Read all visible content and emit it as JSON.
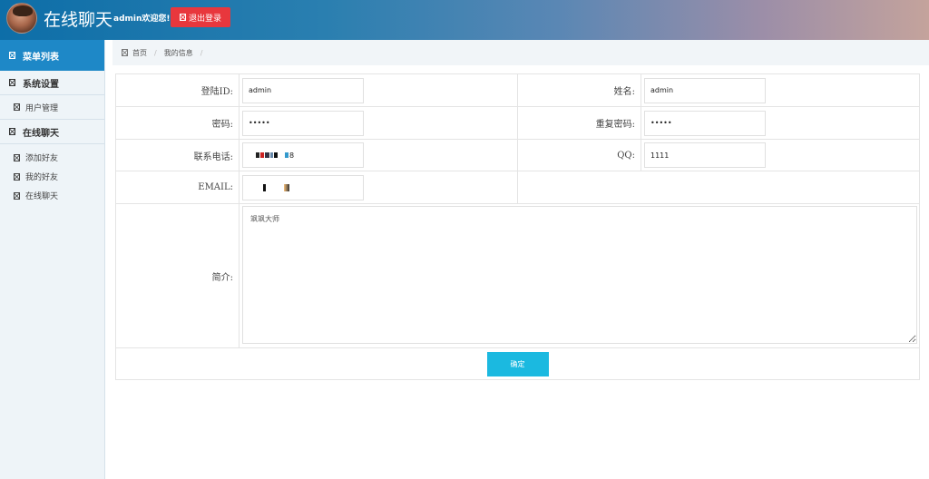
{
  "header": {
    "app_title": "在线聊天",
    "welcome_text": "admin欢迎您!",
    "logout_label": "退出登录",
    "logout_color": "#e8373d"
  },
  "sidebar": {
    "menu_title": "菜单列表",
    "groups": [
      {
        "label": "系统设置",
        "items": [
          {
            "label": "用户管理"
          }
        ]
      },
      {
        "label": "在线聊天",
        "items": [
          {
            "label": "添加好友"
          },
          {
            "label": "我的好友"
          },
          {
            "label": "在线聊天"
          }
        ]
      }
    ]
  },
  "breadcrumb": {
    "home": "首页",
    "current": "我的信息"
  },
  "form": {
    "login_id_label": "登陆ID:",
    "login_id_value": "admin",
    "name_label": "姓名:",
    "name_value": "admin",
    "password_label": "密码:",
    "password_value": "•••••",
    "confirm_password_label": "重复密码:",
    "confirm_password_value": "•••••",
    "phone_label": "联系电话:",
    "phone_visible_suffix": "8",
    "qq_label": "QQ:",
    "qq_value": "1111",
    "email_label": "EMAIL:",
    "intro_label": "简介:",
    "intro_value": "飒飒大师",
    "submit_label": "确定",
    "submit_color": "#1bb9e0"
  },
  "icons": {
    "menu": "list-icon",
    "group": "folder-icon",
    "item": "file-icon",
    "logout": "logout-icon",
    "home": "home-icon"
  }
}
